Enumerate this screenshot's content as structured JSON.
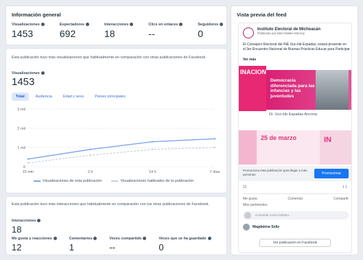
{
  "general": {
    "title": "Información general",
    "stats": [
      {
        "label": "Visualizaciones",
        "value": "1453"
      },
      {
        "label": "Espectadores",
        "value": "692"
      },
      {
        "label": "Interacciones",
        "value": "18"
      },
      {
        "label": "Clics en enlaces",
        "value": "--"
      },
      {
        "label": "Seguidores",
        "value": "0"
      }
    ]
  },
  "views_card": {
    "intro": "Esta publicación tuvo más visualizaciones que habitualmente en comparación con otras publicaciones de Facebook.",
    "views_label": "Visualizaciones",
    "views_value": "1453",
    "tabs": [
      "Total",
      "Audiencia",
      "Edad y sexo",
      "Países principales"
    ],
    "active_tab": 0,
    "legend": [
      {
        "name": "Visualizaciones de esta publicación",
        "color": "#7ea6ea"
      },
      {
        "name": "Visualizaciones habituales de la publicación",
        "color": "#c7d0dc"
      }
    ]
  },
  "chart_data": {
    "type": "line",
    "x": [
      "15 min",
      "2 h",
      "14 h",
      "7 días"
    ],
    "y_ticks": [
      "0",
      "1 mil",
      "2 mil",
      "3 mil"
    ],
    "ylim": [
      0,
      3000
    ],
    "series": [
      {
        "name": "Visualizaciones de esta publicación",
        "values": [
          400,
          900,
          1300,
          1453
        ],
        "color": "#7ea6ea"
      },
      {
        "name": "Visualizaciones habituales de la publicación",
        "values": [
          200,
          600,
          900,
          1000
        ],
        "color": "#c7d0dc"
      }
    ],
    "grid": true,
    "legend_position": "bottom"
  },
  "interactions_card": {
    "intro": "Esta publicación tuvo más interacciones que habitualmente en comparación con tus otras publicaciones de Facebook.",
    "label": "Interacciones",
    "value": "18",
    "stats": [
      {
        "label": "Me gusta y reacciones",
        "value": "12"
      },
      {
        "label": "Comentarios",
        "value": "1"
      },
      {
        "label": "Veces compartido",
        "value": "--"
      },
      {
        "label": "Veces que se ha guardado",
        "value": "0"
      }
    ]
  },
  "feed": {
    "title": "Vista previa del feed",
    "page_name": "Instituto Electoral de Michoacán",
    "post_meta": "Publicado por Nati Vidales Monroy",
    "post_text": "El Consejero Electoral del INE Uuc-kib Espadas, estará presente en el 3er Encuentro Nacional de Buenas Prácticas Educar para Participar",
    "see_more": "Ver más",
    "image_left_text": "INACIONAL",
    "banner_text": "Democracia diferenciada para las infancias y las juventudes",
    "banner_sub": "Dr. Uuc-kib Espadas Ancona",
    "date_text": "25 de marzo",
    "in_text": "IN",
    "promo_text": "Promociona esta publicación para llegar a más personas",
    "promo_button": "Promocionar",
    "reactions": "12",
    "counts": "1  1",
    "actions": [
      "Me gusta",
      "Comentar",
      "Compartir"
    ],
    "relevant": "Más pertinentes",
    "comment_placeholder": "Comentar como Instituto...",
    "comment_author": "Magdalena Solis",
    "view_button": "Ver publicación en Facebook"
  }
}
